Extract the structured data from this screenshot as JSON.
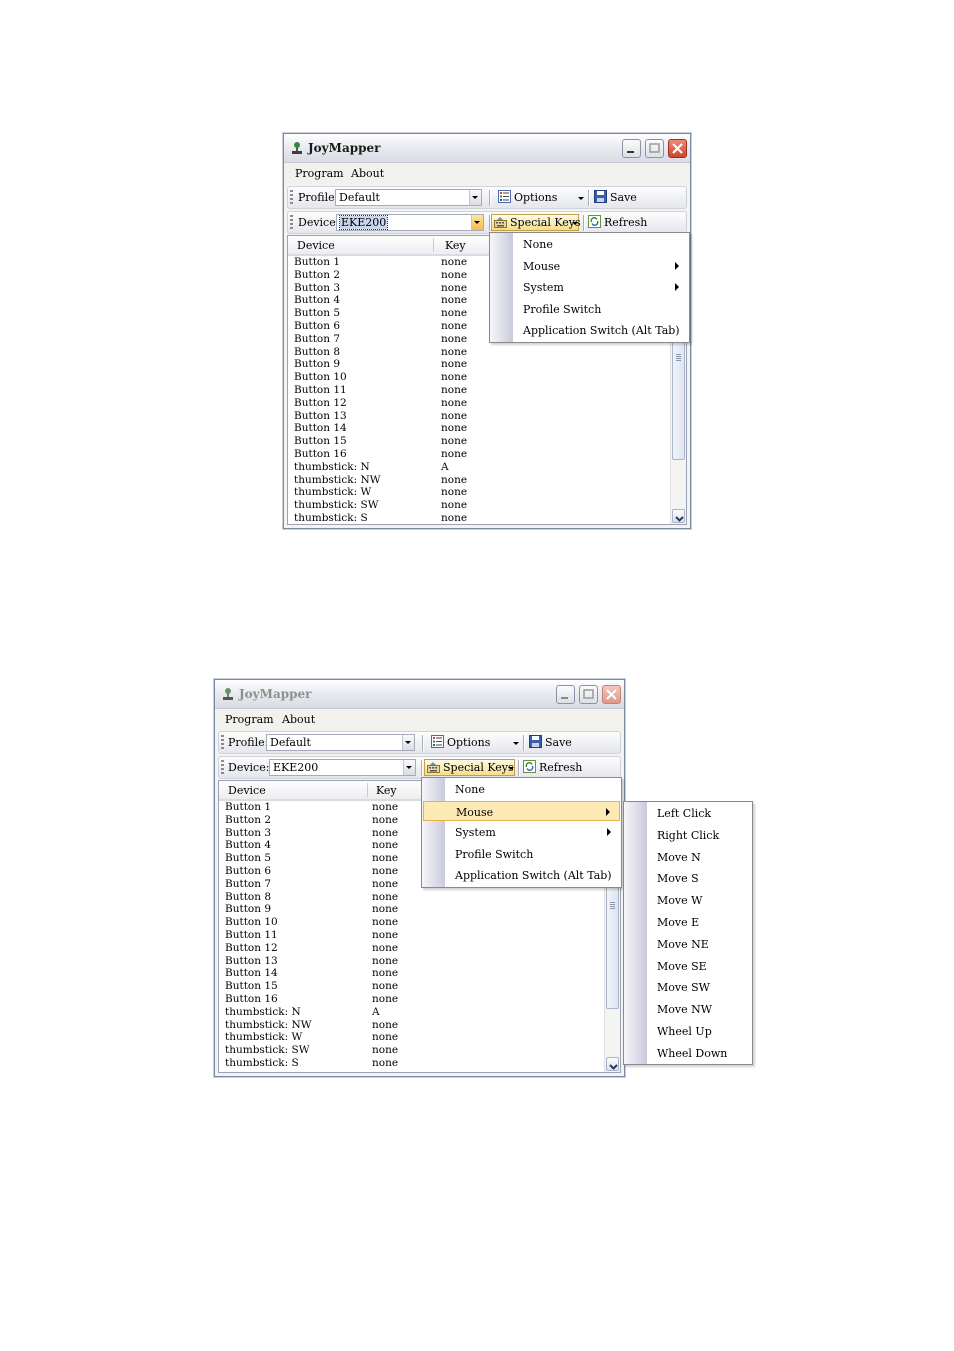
{
  "app": {
    "title": "JoyMapper"
  },
  "menu": {
    "program": "Program",
    "about": "About"
  },
  "toolbar": {
    "profile_label": "Profile:",
    "profile_value": "Default",
    "options": "Options",
    "save": "Save",
    "device_label": "Device:",
    "device_value": "EKE200",
    "special_keys": "Special Keys",
    "refresh": "Refresh"
  },
  "list": {
    "col_device": "Device",
    "col_key": "Key",
    "rows": [
      {
        "device": "Button 1",
        "key": "none"
      },
      {
        "device": "Button 2",
        "key": "none"
      },
      {
        "device": "Button 3",
        "key": "none"
      },
      {
        "device": "Button 4",
        "key": "none"
      },
      {
        "device": "Button 5",
        "key": "none"
      },
      {
        "device": "Button 6",
        "key": "none"
      },
      {
        "device": "Button 7",
        "key": "none"
      },
      {
        "device": "Button 8",
        "key": "none"
      },
      {
        "device": "Button 9",
        "key": "none"
      },
      {
        "device": "Button 10",
        "key": "none"
      },
      {
        "device": "Button 11",
        "key": "none"
      },
      {
        "device": "Button 12",
        "key": "none"
      },
      {
        "device": "Button 13",
        "key": "none"
      },
      {
        "device": "Button 14",
        "key": "none"
      },
      {
        "device": "Button 15",
        "key": "none"
      },
      {
        "device": "Button 16",
        "key": "none"
      },
      {
        "device": "thumbstick: N",
        "key": "A"
      },
      {
        "device": "thumbstick: NW",
        "key": "none"
      },
      {
        "device": "thumbstick: W",
        "key": "none"
      },
      {
        "device": "thumbstick: SW",
        "key": "none"
      },
      {
        "device": "thumbstick: S",
        "key": "none"
      }
    ]
  },
  "special_keys_menu": {
    "items": [
      {
        "label": "None",
        "submenu": false
      },
      {
        "label": "Mouse",
        "submenu": true
      },
      {
        "label": "System",
        "submenu": true
      },
      {
        "label": "Profile Switch",
        "submenu": false
      },
      {
        "label": "Application Switch (Alt Tab)",
        "submenu": false
      }
    ],
    "highlighted_in_second_screenshot": "Mouse"
  },
  "mouse_submenu": {
    "items": [
      "Left Click",
      "Right Click",
      "Move N",
      "Move S",
      "Move W",
      "Move E",
      "Move NE",
      "Move SE",
      "Move SW",
      "Move NW",
      "Wheel Up",
      "Wheel Down"
    ]
  },
  "colors": {
    "menu_highlight": "#fde9b4",
    "close_button": "#d0452b",
    "window_frame": "#7a8aa5"
  }
}
